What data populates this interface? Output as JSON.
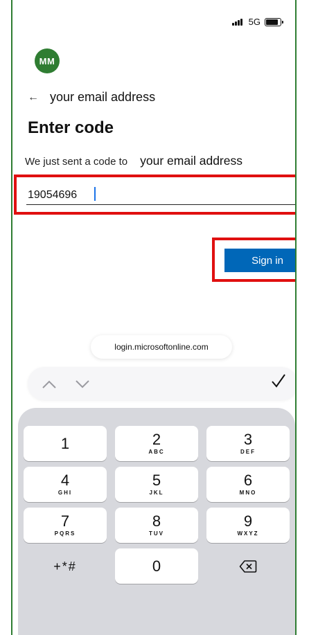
{
  "status_bar": {
    "network": "5G"
  },
  "account": {
    "initials": "MM",
    "email": "your email address"
  },
  "page": {
    "back_arrow": "←",
    "title": "Enter code",
    "sent_label": "We just sent a code to",
    "sent_email": "your email address"
  },
  "code_input": {
    "value": "19054696"
  },
  "sign_in": {
    "label": "Sign in",
    "color": "#0067b8"
  },
  "browser": {
    "url": "login.microsoftonline.com"
  },
  "keyboard_toolbar": {
    "prev_icon": "chevron-up-icon",
    "next_icon": "chevron-down-icon",
    "done_icon": "checkmark-icon"
  },
  "keypad": [
    {
      "num": "1",
      "letters": ""
    },
    {
      "num": "2",
      "letters": "ABC"
    },
    {
      "num": "3",
      "letters": "DEF"
    },
    {
      "num": "4",
      "letters": "GHI"
    },
    {
      "num": "5",
      "letters": "JKL"
    },
    {
      "num": "6",
      "letters": "MNO"
    },
    {
      "num": "7",
      "letters": "PQRS"
    },
    {
      "num": "8",
      "letters": "TUV"
    },
    {
      "num": "9",
      "letters": "WXYZ"
    },
    {
      "num": "+*#",
      "letters": ""
    },
    {
      "num": "0",
      "letters": ""
    }
  ],
  "colors": {
    "accent_green": "#2f7d32",
    "highlight_red": "#e01010",
    "sign_in_blue": "#0067b8"
  }
}
